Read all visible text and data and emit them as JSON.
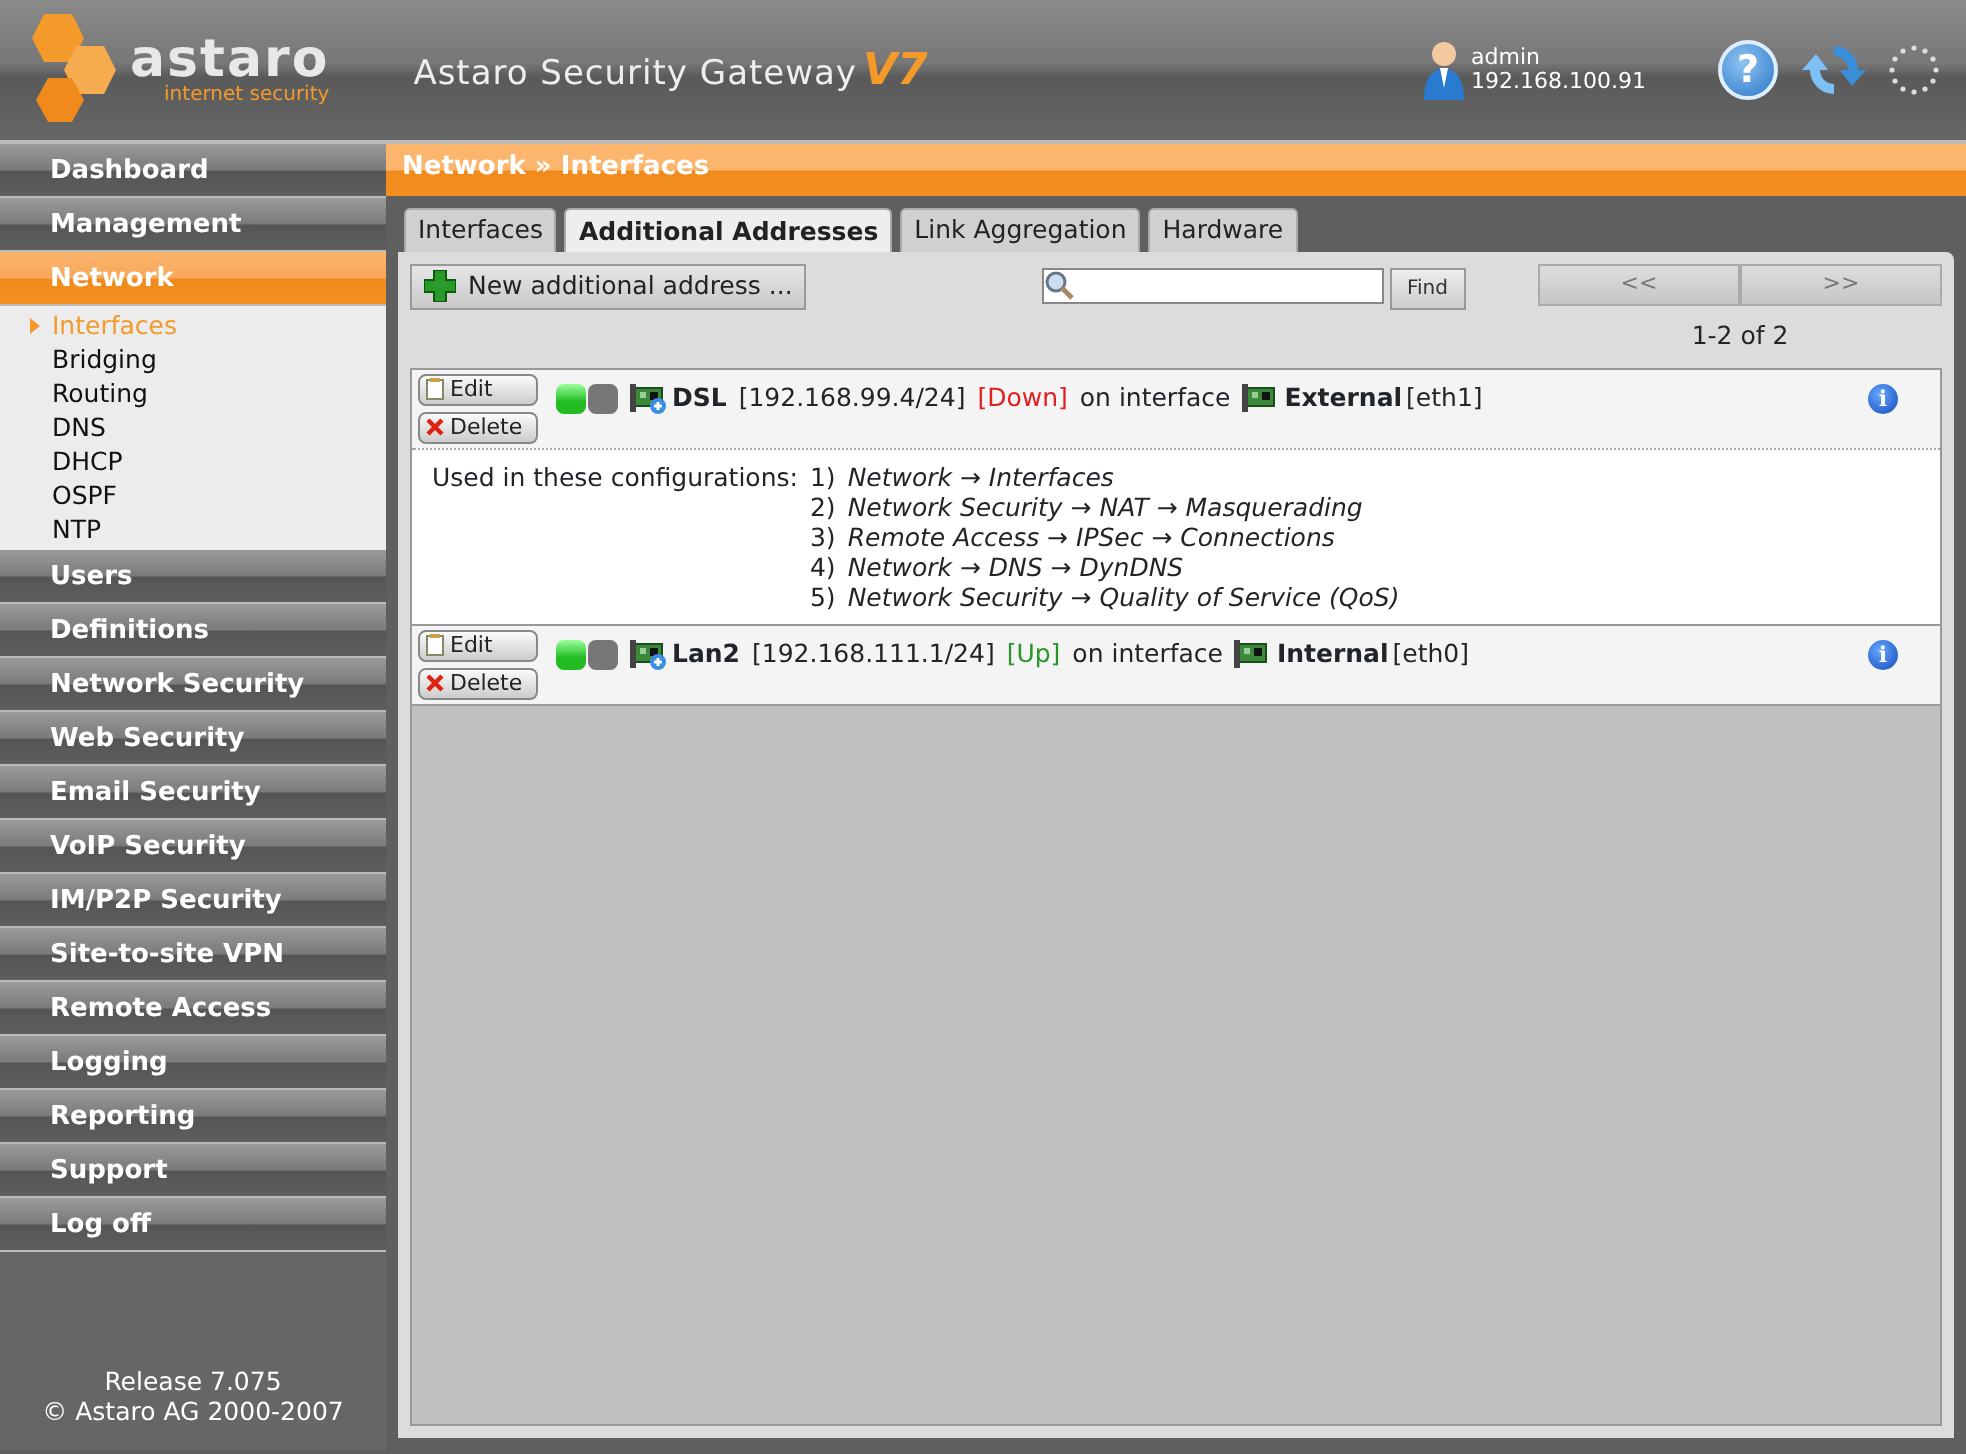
{
  "header": {
    "logo": "astaro",
    "logo_tagline": "internet security",
    "product": "Astaro Security Gateway",
    "version": "V7",
    "user": "admin",
    "ip": "192.168.100.91",
    "help_glyph": "?"
  },
  "sidebar": {
    "items": [
      {
        "label": "Dashboard",
        "selected": false
      },
      {
        "label": "Management",
        "selected": false
      },
      {
        "label": "Network",
        "selected": true,
        "children": [
          {
            "label": "Interfaces",
            "selected": true
          },
          {
            "label": "Bridging",
            "selected": false
          },
          {
            "label": "Routing",
            "selected": false
          },
          {
            "label": "DNS",
            "selected": false
          },
          {
            "label": "DHCP",
            "selected": false
          },
          {
            "label": "OSPF",
            "selected": false
          },
          {
            "label": "NTP",
            "selected": false
          }
        ]
      },
      {
        "label": "Users",
        "selected": false
      },
      {
        "label": "Definitions",
        "selected": false
      },
      {
        "label": "Network Security",
        "selected": false
      },
      {
        "label": "Web Security",
        "selected": false
      },
      {
        "label": "Email Security",
        "selected": false
      },
      {
        "label": "VoIP Security",
        "selected": false
      },
      {
        "label": "IM/P2P Security",
        "selected": false
      },
      {
        "label": "Site-to-site VPN",
        "selected": false
      },
      {
        "label": "Remote Access",
        "selected": false
      },
      {
        "label": "Logging",
        "selected": false
      },
      {
        "label": "Reporting",
        "selected": false
      },
      {
        "label": "Support",
        "selected": false
      },
      {
        "label": "Log off",
        "selected": false
      }
    ],
    "release": "Release 7.075",
    "copyright": "© Astaro AG 2000-2007"
  },
  "breadcrumb": "Network » Interfaces",
  "tabs": [
    {
      "label": "Interfaces",
      "selected": false
    },
    {
      "label": "Additional Addresses",
      "selected": true
    },
    {
      "label": "Link Aggregation",
      "selected": false
    },
    {
      "label": "Hardware",
      "selected": false
    }
  ],
  "toolbar": {
    "new_button": "New additional address ...",
    "find_button": "Find",
    "prev": "<<",
    "next": ">>",
    "paging_disabled": true,
    "count": "1-2 of 2"
  },
  "addresses": [
    {
      "edit": "Edit",
      "delete": "Delete",
      "enabled": true,
      "name": "DSL",
      "cidr": "[192.168.99.4/24]",
      "status": "[Down]",
      "up": false,
      "on_interface": "on interface",
      "interface": "External",
      "device": "[eth1]",
      "info_glyph": "i",
      "usage_label": "Used in these configurations:",
      "usage": [
        {
          "number": "1)",
          "path": "Network → Interfaces"
        },
        {
          "number": "2)",
          "path": "Network Security → NAT → Masquerading"
        },
        {
          "number": "3)",
          "path": "Remote Access → IPSec → Connections"
        },
        {
          "number": "4)",
          "path": "Network → DNS → DynDNS"
        },
        {
          "number": "5)",
          "path": "Network Security → Quality of Service (QoS)"
        }
      ]
    },
    {
      "edit": "Edit",
      "delete": "Delete",
      "enabled": true,
      "name": "Lan2",
      "cidr": "[192.168.111.1/24]",
      "status": "[Up]",
      "up": true,
      "on_interface": "on interface",
      "interface": "Internal",
      "device": "[eth0]",
      "info_glyph": "i"
    }
  ]
}
